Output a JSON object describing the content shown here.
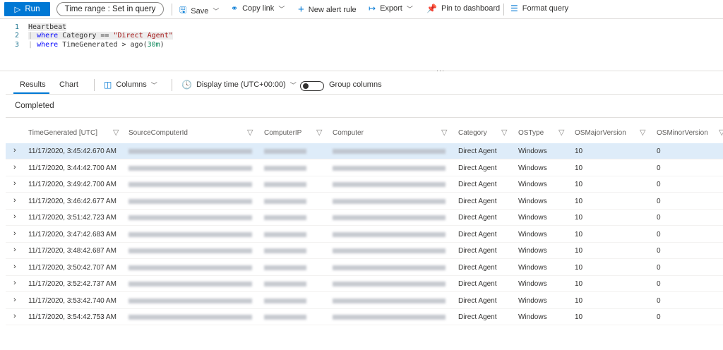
{
  "toolbar": {
    "run": "Run",
    "time_range_label": "Time range :",
    "time_range_value": "Set in query",
    "save": "Save",
    "copy_link": "Copy link",
    "new_alert_rule": "New alert rule",
    "export": "Export",
    "pin": "Pin to dashboard",
    "format": "Format query"
  },
  "editor": {
    "lines": [
      {
        "n": "1",
        "text": "Heartbeat"
      },
      {
        "n": "2",
        "pipe": "|",
        "kw": "where",
        "a": " Category == ",
        "str": "\"Direct Agent\""
      },
      {
        "n": "3",
        "pipe": "|",
        "kw": "where",
        "a": " TimeGenerated > ago(",
        "num": "30m",
        "b": ")"
      }
    ]
  },
  "results": {
    "tab_results": "Results",
    "tab_chart": "Chart",
    "columns": "Columns",
    "display_time": "Display time (UTC+00:00)",
    "group_columns": "Group columns",
    "status": "Completed",
    "headers": [
      "TimeGenerated [UTC]",
      "SourceComputerId",
      "ComputerIP",
      "Computer",
      "Category",
      "OSType",
      "OSMajorVersion",
      "OSMinorVersion"
    ],
    "rows": [
      {
        "time": "11/17/2020, 3:45:42.670 AM",
        "category": "Direct Agent",
        "os": "Windows",
        "major": "10",
        "minor": "0"
      },
      {
        "time": "11/17/2020, 3:44:42.700 AM",
        "category": "Direct Agent",
        "os": "Windows",
        "major": "10",
        "minor": "0"
      },
      {
        "time": "11/17/2020, 3:49:42.700 AM",
        "category": "Direct Agent",
        "os": "Windows",
        "major": "10",
        "minor": "0"
      },
      {
        "time": "11/17/2020, 3:46:42.677 AM",
        "category": "Direct Agent",
        "os": "Windows",
        "major": "10",
        "minor": "0"
      },
      {
        "time": "11/17/2020, 3:51:42.723 AM",
        "category": "Direct Agent",
        "os": "Windows",
        "major": "10",
        "minor": "0"
      },
      {
        "time": "11/17/2020, 3:47:42.683 AM",
        "category": "Direct Agent",
        "os": "Windows",
        "major": "10",
        "minor": "0"
      },
      {
        "time": "11/17/2020, 3:48:42.687 AM",
        "category": "Direct Agent",
        "os": "Windows",
        "major": "10",
        "minor": "0"
      },
      {
        "time": "11/17/2020, 3:50:42.707 AM",
        "category": "Direct Agent",
        "os": "Windows",
        "major": "10",
        "minor": "0"
      },
      {
        "time": "11/17/2020, 3:52:42.737 AM",
        "category": "Direct Agent",
        "os": "Windows",
        "major": "10",
        "minor": "0"
      },
      {
        "time": "11/17/2020, 3:53:42.740 AM",
        "category": "Direct Agent",
        "os": "Windows",
        "major": "10",
        "minor": "0"
      },
      {
        "time": "11/17/2020, 3:54:42.753 AM",
        "category": "Direct Agent",
        "os": "Windows",
        "major": "10",
        "minor": "0"
      }
    ]
  }
}
